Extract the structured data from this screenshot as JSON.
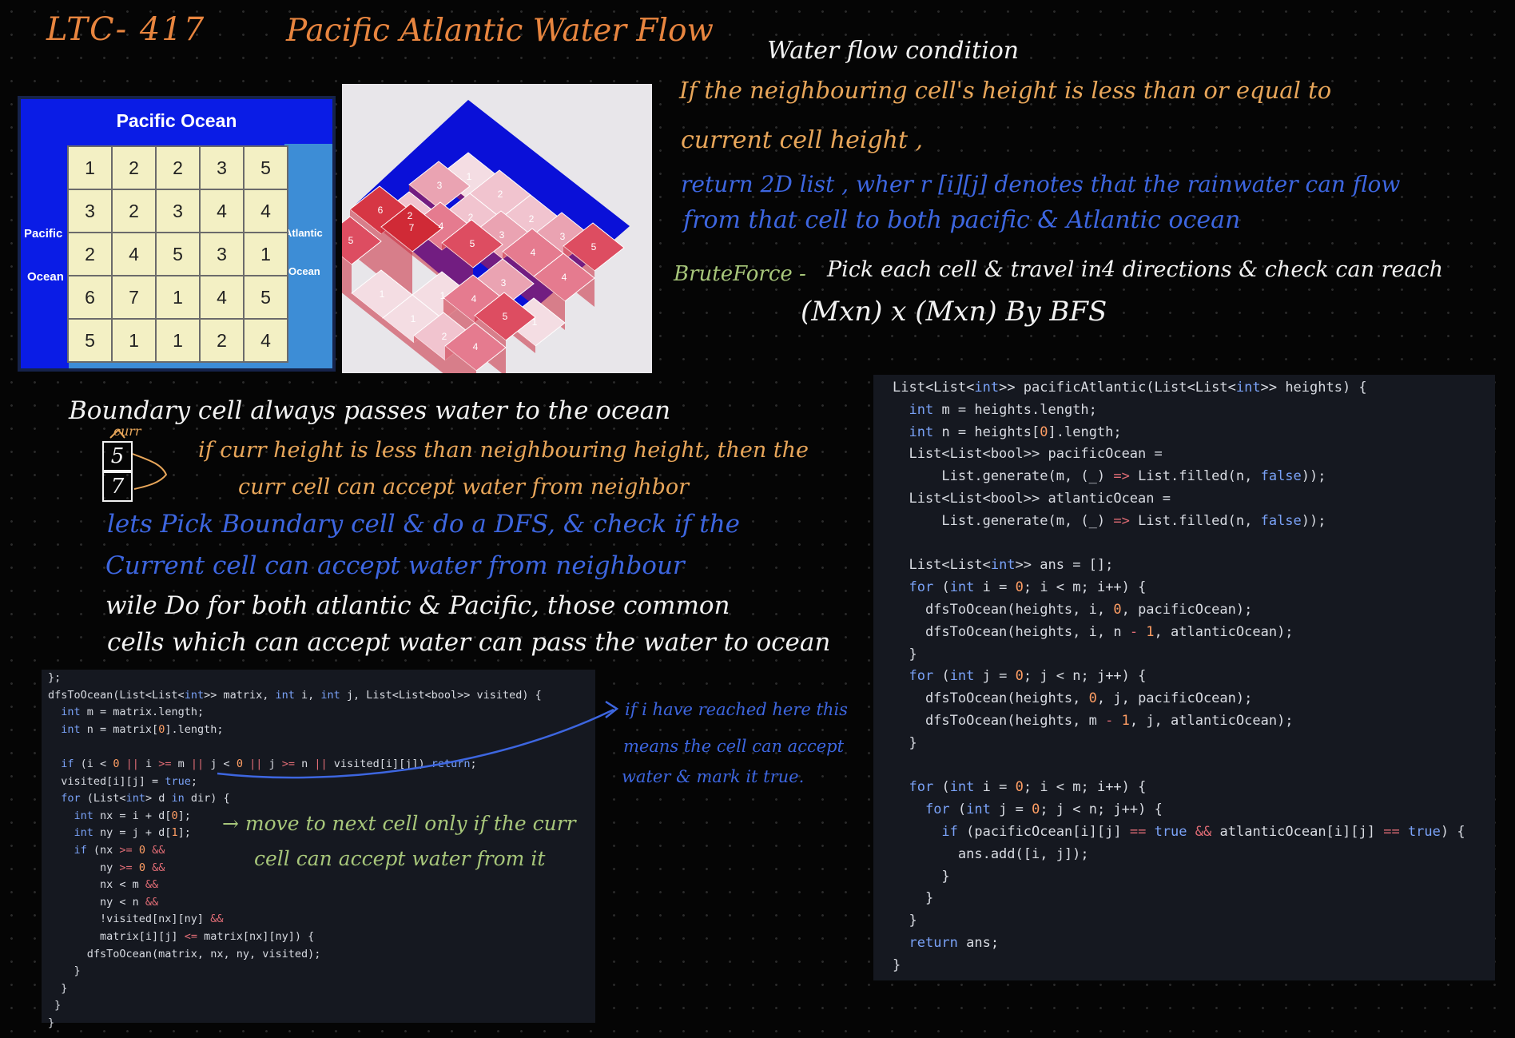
{
  "title": {
    "code": "LTC- 417",
    "name": "Pacific Atlantic Water Flow"
  },
  "notes": {
    "condition_heading": "Water flow condition",
    "condition_line1": "If the neighbouring cell's height is less than or equal to",
    "condition_line2": "current cell height ,",
    "return_line1": "return 2D list , wher r [i][j] denotes that the rainwater can flow",
    "return_line2": "from that cell to both pacific & Atlantic ocean",
    "brute_label": "BruteForce -",
    "brute_text": "Pick each cell & travel in4 directions & check can reach",
    "complexity": "(Mxn)  x (Mxn)   By BFS",
    "boundary": "Boundary cell always passes water to the ocean",
    "curr_label": "curr",
    "mini_top": "5",
    "mini_bottom": "7",
    "yellow1": "if curr height is less than neighbouring height, then the",
    "yellow2": "curr cell can accept water from neighbor",
    "blue1": "lets Pick Boundary cell & do a DFS, & check if the",
    "blue2": "Current cell can accept water from neighbour",
    "white1": "wile Do for both atlantic & Pacific, those common",
    "white2": "cells which can accept water can pass the water to ocean",
    "annot1": "if i have reached here this",
    "annot2": "means the cell can accept",
    "annot3": "water & mark it true.",
    "green1": "→ move to next cell only if the curr",
    "green2": "cell can accept water from it"
  },
  "grid_image": {
    "top_label": "Pacific Ocean",
    "left_label_1": "Pacific",
    "left_label_2": "Ocean",
    "right_label_1": "Atlantic",
    "right_label_2": "Ocean",
    "rows": [
      [
        "1",
        "2",
        "2",
        "3",
        "5"
      ],
      [
        "3",
        "2",
        "3",
        "4",
        "4"
      ],
      [
        "2",
        "4",
        "5",
        "3",
        "1"
      ],
      [
        "6",
        "7",
        "1",
        "4",
        "5"
      ],
      [
        "5",
        "1",
        "1",
        "2",
        "4"
      ]
    ]
  },
  "iso_image": {
    "labels": [
      "5",
      "4",
      "2",
      "2",
      "4",
      "1",
      "2",
      "2",
      "3",
      "3",
      "1",
      "2",
      "5",
      "4",
      "5",
      "3",
      "4",
      "2",
      "5",
      "4",
      "7",
      "6",
      "5"
    ]
  },
  "code_right": [
    "List<List<int>> pacificAtlantic(List<List<int>> heights) {",
    "  int m = heights.length;",
    "  int n = heights[0].length;",
    "  List<List<bool>> pacificOcean =",
    "      List.generate(m, (_) => List.filled(n, false));",
    "  List<List<bool>> atlanticOcean =",
    "      List.generate(m, (_) => List.filled(n, false));",
    "",
    "  List<List<int>> ans = [];",
    "  for (int i = 0; i < m; i++) {",
    "    dfsToOcean(heights, i, 0, pacificOcean);",
    "    dfsToOcean(heights, i, n - 1, atlanticOcean);",
    "  }",
    "  for (int j = 0; j < n; j++) {",
    "    dfsToOcean(heights, 0, j, pacificOcean);",
    "    dfsToOcean(heights, m - 1, j, atlanticOcean);",
    "  }",
    "",
    "  for (int i = 0; i < m; i++) {",
    "    for (int j = 0; j < n; j++) {",
    "      if (pacificOcean[i][j] == true && atlanticOcean[i][j] == true) {",
    "        ans.add([i, j]);",
    "      }",
    "    }",
    "  }",
    "  return ans;",
    "}"
  ],
  "code_left": [
    "};",
    "dfsToOcean(List<List<int>> matrix, int i, int j, List<List<bool>> visited) {",
    "  int m = matrix.length;",
    "  int n = matrix[0].length;",
    "",
    "  if (i < 0 || i >= m || j < 0 || j >= n || visited[i][j]) return;",
    "  visited[i][j] = true;",
    "  for (List<int> d in dir) {",
    "    int nx = i + d[0];",
    "    int ny = j + d[1];",
    "    if (nx >= 0 &&",
    "        ny >= 0 &&",
    "        nx < m &&",
    "        ny < n &&",
    "        !visited[nx][ny] &&",
    "        matrix[i][j] <= matrix[nx][ny]) {",
    "      dfsToOcean(matrix, nx, ny, visited);",
    "    }",
    "  }",
    " }",
    "}"
  ]
}
